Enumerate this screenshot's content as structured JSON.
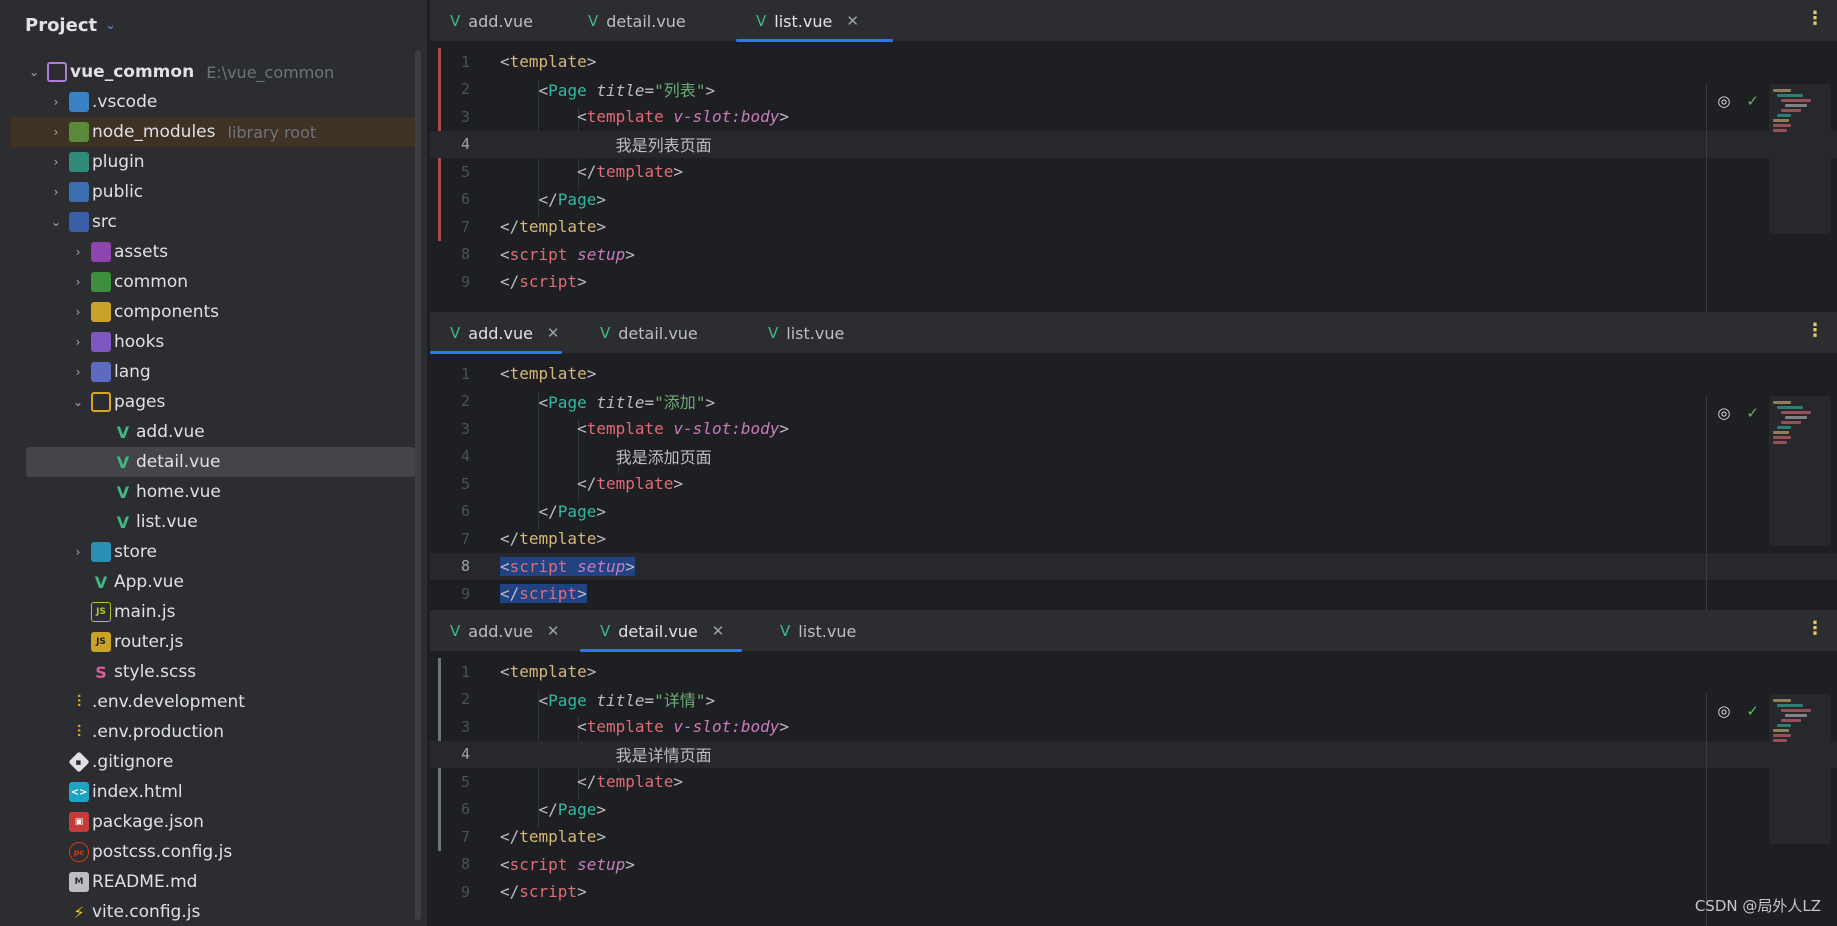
{
  "sidebar": {
    "title": "Project",
    "root": {
      "name": "vue_common",
      "path": "E:\\vue_common"
    },
    "items": [
      {
        "label": ".vscode",
        "level": 1,
        "kind": "folder",
        "icon": "folder-vscode-icon",
        "arrow": "›"
      },
      {
        "label": "node_modules",
        "level": 1,
        "kind": "folder",
        "icon": "folder-node-icon",
        "arrow": "›",
        "hint": "library root"
      },
      {
        "label": "plugin",
        "level": 1,
        "kind": "folder",
        "icon": "folder-plugin-icon",
        "arrow": "›"
      },
      {
        "label": "public",
        "level": 1,
        "kind": "folder",
        "icon": "folder-public-icon",
        "arrow": "›"
      },
      {
        "label": "src",
        "level": 1,
        "kind": "folder",
        "icon": "folder-src-icon",
        "arrow": "⌄"
      },
      {
        "label": "assets",
        "level": 2,
        "kind": "folder",
        "icon": "folder-assets-icon",
        "arrow": "›"
      },
      {
        "label": "common",
        "level": 2,
        "kind": "folder",
        "icon": "folder-common-icon",
        "arrow": "›"
      },
      {
        "label": "components",
        "level": 2,
        "kind": "folder",
        "icon": "folder-components-icon",
        "arrow": "›"
      },
      {
        "label": "hooks",
        "level": 2,
        "kind": "folder",
        "icon": "folder-hooks-icon",
        "arrow": "›"
      },
      {
        "label": "lang",
        "level": 2,
        "kind": "folder",
        "icon": "folder-lang-icon",
        "arrow": "›"
      },
      {
        "label": "pages",
        "level": 2,
        "kind": "folder",
        "icon": "folder-pages-icon",
        "arrow": "⌄"
      },
      {
        "label": "add.vue",
        "level": 3,
        "kind": "vue",
        "icon": "vue-icon"
      },
      {
        "label": "detail.vue",
        "level": 3,
        "kind": "vue",
        "icon": "vue-icon",
        "selected": true
      },
      {
        "label": "home.vue",
        "level": 3,
        "kind": "vue",
        "icon": "vue-icon"
      },
      {
        "label": "list.vue",
        "level": 3,
        "kind": "vue",
        "icon": "vue-icon"
      },
      {
        "label": "store",
        "level": 2,
        "kind": "folder",
        "icon": "folder-store-icon",
        "arrow": "›"
      },
      {
        "label": "App.vue",
        "level": 2,
        "kind": "vue",
        "icon": "vue-icon"
      },
      {
        "label": "main.js",
        "level": 2,
        "kind": "js2",
        "icon": "js-icon"
      },
      {
        "label": "router.js",
        "level": 2,
        "kind": "js",
        "icon": "js-icon"
      },
      {
        "label": "style.scss",
        "level": 2,
        "kind": "scss",
        "icon": "scss-icon"
      },
      {
        "label": ".env.development",
        "level": 1,
        "kind": "env",
        "icon": "env-icon"
      },
      {
        "label": ".env.production",
        "level": 1,
        "kind": "env",
        "icon": "env-icon"
      },
      {
        "label": ".gitignore",
        "level": 1,
        "kind": "git",
        "icon": "git-icon"
      },
      {
        "label": "index.html",
        "level": 1,
        "kind": "html",
        "icon": "html-icon"
      },
      {
        "label": "package.json",
        "level": 1,
        "kind": "pkg",
        "icon": "package-icon"
      },
      {
        "label": "postcss.config.js",
        "level": 1,
        "kind": "postcss",
        "icon": "postcss-icon"
      },
      {
        "label": "README.md",
        "level": 1,
        "kind": "md",
        "icon": "markdown-icon"
      },
      {
        "label": "vite.config.js",
        "level": 1,
        "kind": "vite",
        "icon": "vite-icon"
      }
    ]
  },
  "panes": [
    {
      "tabs": [
        {
          "label": "add.vue",
          "active": false,
          "closable": false
        },
        {
          "label": "detail.vue",
          "active": false,
          "closable": false
        },
        {
          "label": "list.vue",
          "active": true,
          "closable": true
        }
      ],
      "title_value": "列表",
      "body_text": "我是列表页面",
      "current_line": 4,
      "selection": false
    },
    {
      "tabs": [
        {
          "label": "add.vue",
          "active": true,
          "closable": true
        },
        {
          "label": "detail.vue",
          "active": false,
          "closable": false
        },
        {
          "label": "list.vue",
          "active": false,
          "closable": false
        }
      ],
      "title_value": "添加",
      "body_text": "我是添加页面",
      "current_line": 8,
      "selection": true
    },
    {
      "tabs": [
        {
          "label": "add.vue",
          "active": false,
          "closable": true
        },
        {
          "label": "detail.vue",
          "active": true,
          "closable": true
        },
        {
          "label": "list.vue",
          "active": false,
          "closable": false
        }
      ],
      "title_value": "详情",
      "body_text": "我是详情页面",
      "current_line": 4,
      "selection": false
    }
  ],
  "code": {
    "line_numbers": [
      "1",
      "2",
      "3",
      "4",
      "5",
      "6",
      "7",
      "8",
      "9"
    ],
    "template_tag": "template",
    "page_tag": "Page",
    "title_attr": "title",
    "slot_attr": "v-slot:body",
    "script_tag": "script",
    "setup_attr": "setup"
  },
  "icons": {
    "inspection": "eye-crossed-icon",
    "status": "check-icon",
    "menu": "kebab-menu-icon"
  },
  "colors": {
    "accent": "#3574f0",
    "vue": "#41b883",
    "background": "#1e1f22",
    "panel": "#2b2d30"
  },
  "watermark": "CSDN @局外人LZ"
}
